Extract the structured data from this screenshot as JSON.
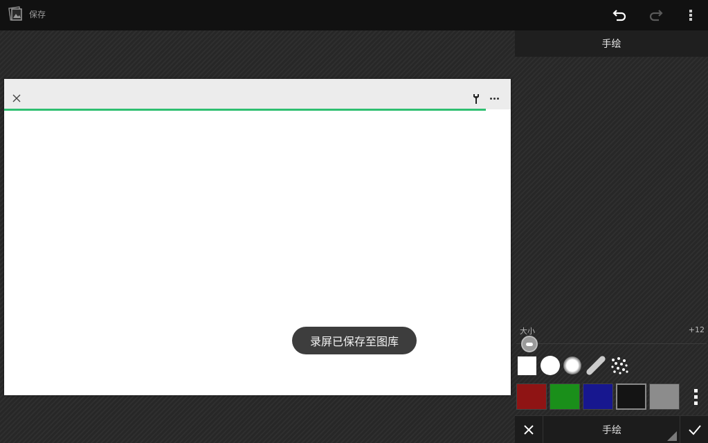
{
  "topbar": {
    "save_label": "保存",
    "icons": [
      "gallery-icon",
      "undo-icon",
      "redo-icon",
      "more-vertical-icon"
    ]
  },
  "panel": {
    "title": "手绘",
    "size_label": "大小",
    "size_value": "+12",
    "brushes": [
      "square",
      "circle",
      "soft-circle",
      "stroke",
      "spray"
    ],
    "colors": [
      {
        "name": "red",
        "hex": "#8f1414"
      },
      {
        "name": "green",
        "hex": "#1a8f1a"
      },
      {
        "name": "blue",
        "hex": "#17178f"
      },
      {
        "name": "black",
        "hex": "#141414",
        "selected": true
      },
      {
        "name": "gray",
        "hex": "#8c8c8c"
      }
    ]
  },
  "bottom": {
    "mode_label": "手绘"
  },
  "canvas": {
    "toolbar_icons": [
      "close-icon",
      "wrench-icon",
      "more-horizontal-icon"
    ],
    "progress_color": "#2fbf71"
  },
  "toast": {
    "text": "录屏已保存至图库"
  }
}
